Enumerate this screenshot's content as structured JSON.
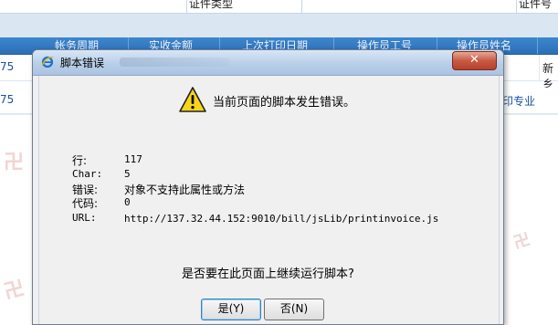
{
  "background": {
    "top_row": {
      "col1": "证件类型",
      "col2": "证件号"
    },
    "grid_header": [
      "帐务周期",
      "实收金额",
      "上次打印日期",
      "操作员工号",
      "操作员姓名"
    ],
    "rows": [
      {
        "left": "75",
        "right": "新乡"
      },
      {
        "left": "75",
        "right": "印专业"
      }
    ]
  },
  "dialog": {
    "title": "脚本错误",
    "close_label": "✕",
    "headline": "当前页面的脚本发生错误。",
    "details": [
      {
        "label": "行:",
        "value": "117"
      },
      {
        "label": "Char:",
        "value": "5"
      },
      {
        "label": "错误:",
        "value": "对象不支持此属性或方法"
      },
      {
        "label": "代码:",
        "value": "0"
      },
      {
        "label": "URL:",
        "value": "http://137.32.44.152:9010/bill/jsLib/printinvoice.js"
      }
    ],
    "question": "是否要在此页面上继续运行脚本?",
    "yes_button": "是(Y)",
    "no_button": "否(N)",
    "icons": {
      "title": "ie-logo-icon",
      "warning": "warning-icon"
    }
  }
}
